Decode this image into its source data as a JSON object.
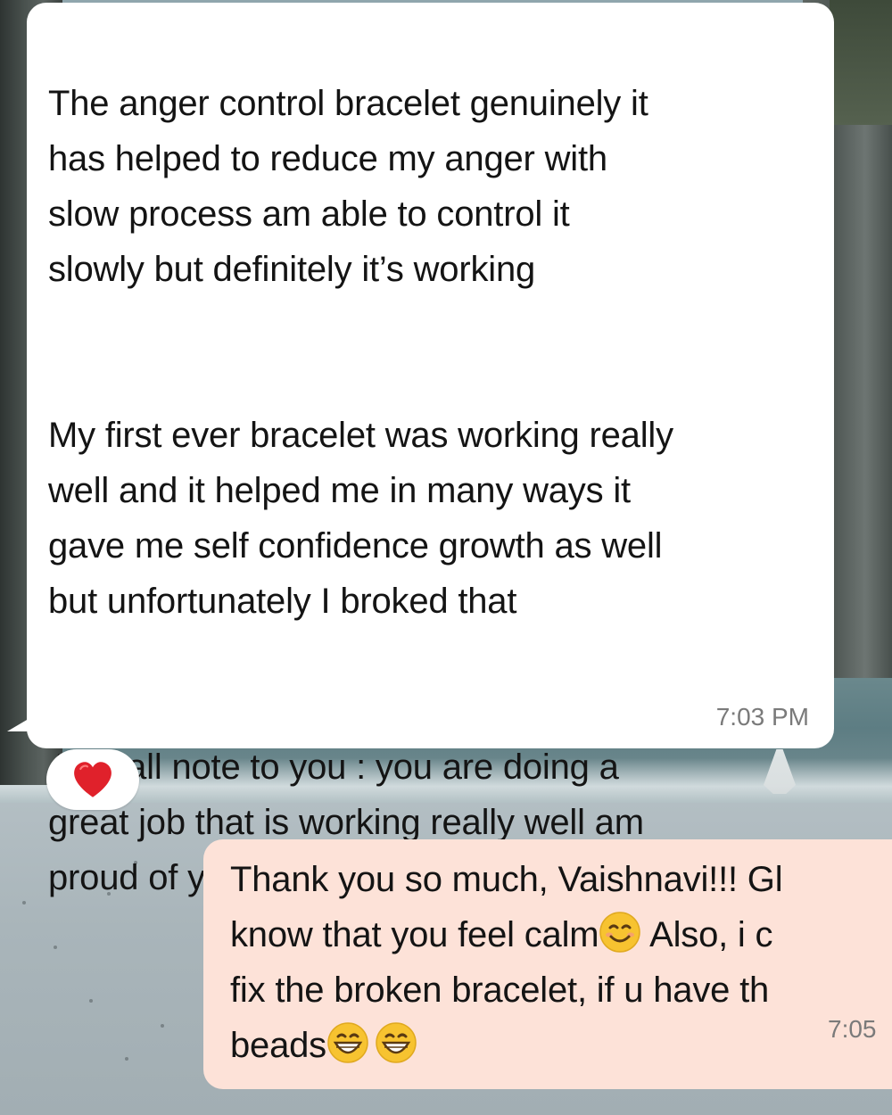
{
  "incoming_message": {
    "paragraphs": [
      "The anger control bracelet genuinely it\nhas helped to reduce my anger with\nslow process am able to control it\nslowly but definitely it’s working",
      "My first ever bracelet was working really\nwell and it helped me in many ways it\ngave me self confidence growth as well\nbut unfortunately I broked that",
      "A small note to you : you are doing a\ngreat job that is working really well am\nproud of you girl keep going"
    ],
    "end_emoji": "red-heart-icon",
    "time": "7:03 PM",
    "reaction": "red-heart-icon"
  },
  "outgoing_message": {
    "line1": "Thank you so much, Vaishnavi!!! Gl",
    "line2_before": "know that you feel calm",
    "line2_after": " Also, i c",
    "line3": "fix the broken bracelet, if u have th",
    "line4": "beads",
    "emojis": [
      "smiling-face-icon",
      "grinning-face-icon",
      "grinning-face-icon"
    ],
    "time": "7:05"
  },
  "colors": {
    "incoming_bubble": "#ffffff",
    "outgoing_bubble": "#fde2d8",
    "timestamp": "#7a7a7a",
    "heart": "#d71920"
  }
}
